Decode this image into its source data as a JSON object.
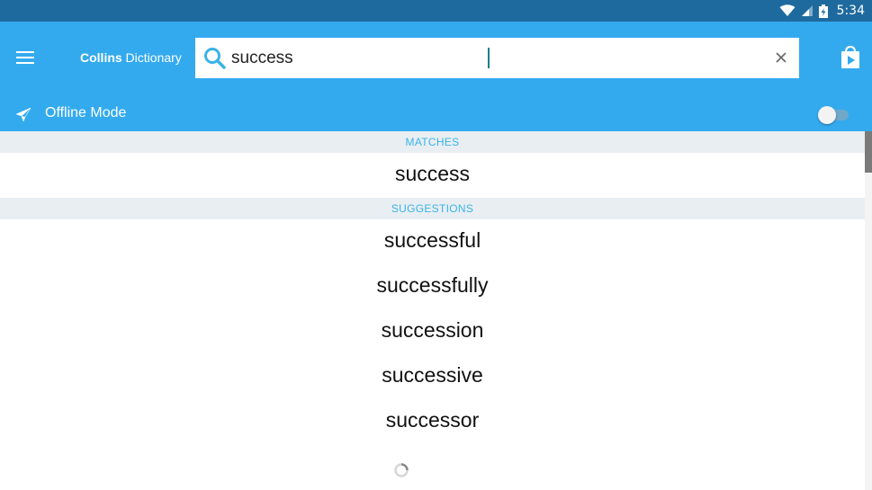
{
  "status_bar": {
    "time": "5:34",
    "icons": [
      "wifi-icon",
      "signal-icon",
      "battery-charging-icon"
    ]
  },
  "app_bar": {
    "brand_bold": "Collins",
    "brand_rest": " Dictionary",
    "menu_icon": "hamburger-menu-icon",
    "store_icon": "play-store-icon",
    "color": "#33aaee"
  },
  "search": {
    "value": "success",
    "icon": "search-icon",
    "clear_icon": "close-icon"
  },
  "offline": {
    "label": "Offline Mode",
    "icon": "airplane-icon",
    "enabled": false
  },
  "matches": {
    "header": "MATCHES",
    "items": [
      "success"
    ]
  },
  "suggestions": {
    "header": "SUGGESTIONS",
    "items": [
      "successful",
      "successfully",
      "succession",
      "successive",
      "successor"
    ]
  },
  "accent_color": "#39b3e6"
}
